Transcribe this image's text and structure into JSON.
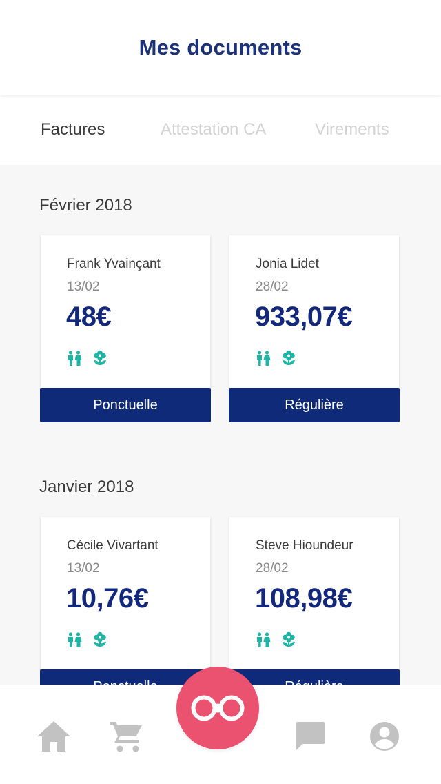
{
  "header": {
    "title": "Mes documents"
  },
  "tabs": [
    {
      "label": "Factures",
      "active": true
    },
    {
      "label": "Attestation CA",
      "active": false
    },
    {
      "label": "Virements",
      "active": false
    }
  ],
  "groups": [
    {
      "month": "Février 2018",
      "cards": [
        {
          "name": "Frank Yvainçant",
          "date": "13/02",
          "amount": "48€",
          "type": "Ponctuelle",
          "icons": [
            "children-icon",
            "flower-icon"
          ]
        },
        {
          "name": "Jonia Lidet",
          "date": "28/02",
          "amount": "933,07€",
          "type": "Régulière",
          "icons": [
            "children-icon",
            "flower-icon"
          ]
        }
      ]
    },
    {
      "month": "Janvier 2018",
      "cards": [
        {
          "name": "Cécile Vivartant",
          "date": "13/02",
          "amount": "10,76€",
          "type": "Ponctuelle",
          "icons": [
            "children-icon",
            "flower-icon"
          ]
        },
        {
          "name": "Steve Hioundeur",
          "date": "28/02",
          "amount": "108,98€",
          "type": "Régulière",
          "icons": [
            "children-icon",
            "flower-icon"
          ]
        }
      ]
    }
  ],
  "bottom_nav": {
    "items": [
      "home-icon",
      "cart-icon",
      "infinity-icon",
      "chat-icon",
      "account-icon"
    ],
    "active_color": "#ea526f",
    "icon_color": "#c2c2c2"
  },
  "colors": {
    "brand": "#1d3379",
    "button": "#0e2a79",
    "accent_icons": "#1fb5a6",
    "fab": "#ea526f"
  }
}
